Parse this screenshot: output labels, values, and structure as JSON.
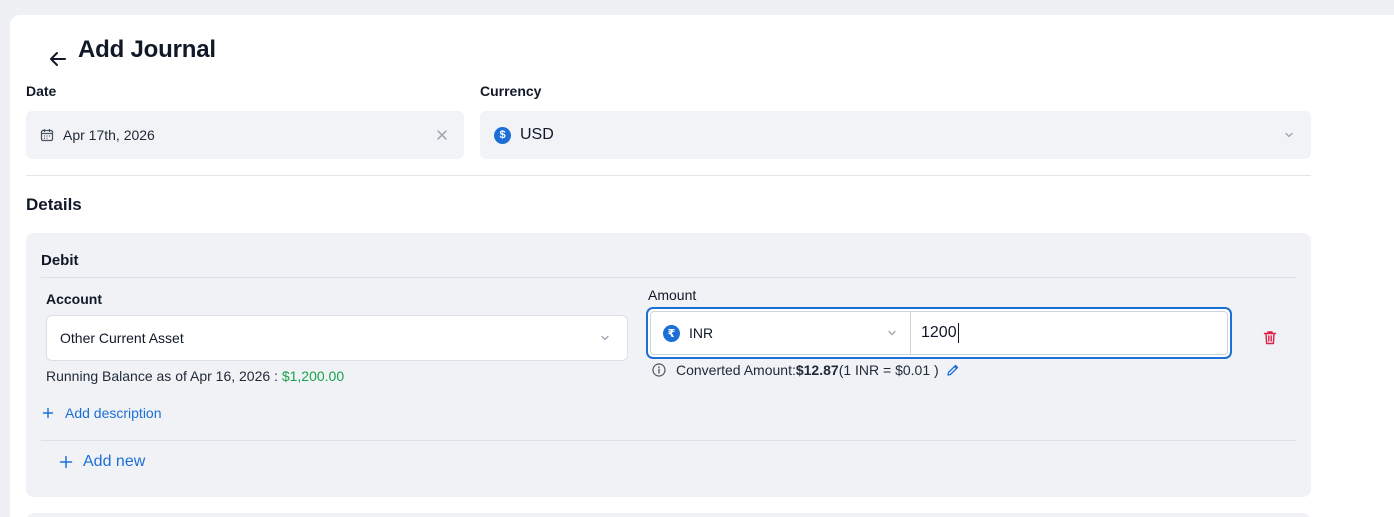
{
  "header": {
    "title": "Add Journal"
  },
  "date_field": {
    "label": "Date",
    "value": "Apr 17th, 2026"
  },
  "currency_field": {
    "label": "Currency",
    "value": "USD",
    "symbol": "$"
  },
  "details": {
    "title": "Details"
  },
  "debit": {
    "title": "Debit",
    "account": {
      "label": "Account",
      "value": "Other Current Asset"
    },
    "running_balance": {
      "prefix": "Running Balance as of Apr 16, 2026 : ",
      "amount": "$1,200.00"
    },
    "add_description": "Add description",
    "amount": {
      "label": "Amount",
      "currency": "INR",
      "currency_symbol": "₹",
      "value": "1200"
    },
    "converted": {
      "prefix": "Converted Amount: ",
      "amount": "$12.87",
      "rate": " (1 INR = $0.01 )"
    },
    "add_new": "Add new"
  },
  "colors": {
    "accent": "#1d6fd8",
    "positive": "#16a34a",
    "danger": "#e11d48"
  }
}
